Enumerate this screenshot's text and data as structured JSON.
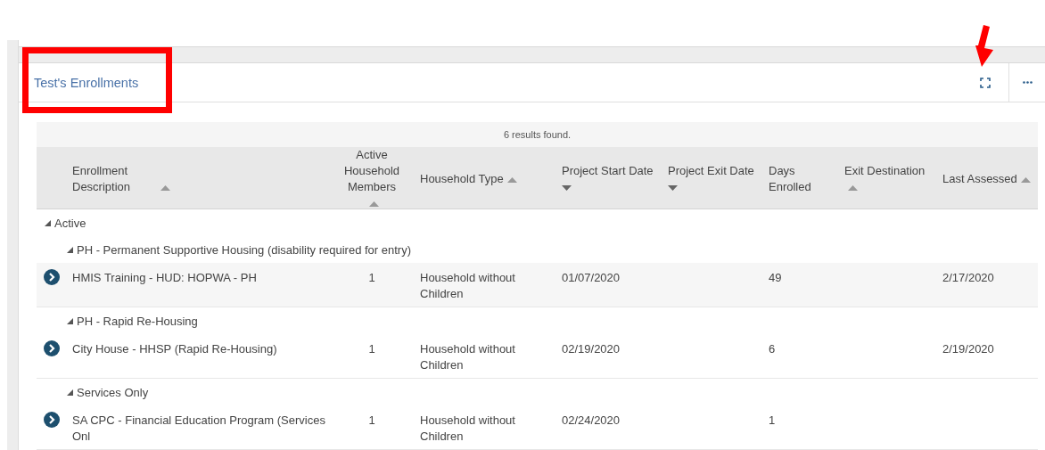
{
  "panel": {
    "title": "Test's Enrollments"
  },
  "toolbar": [
    {
      "kind": "expand"
    },
    {
      "kind": "more"
    }
  ],
  "results": "6 results found.",
  "columns": [
    {
      "label": "Enrollment Description",
      "kind": "text",
      "sorted_ascending": true
    },
    {
      "label": "Active Household Members",
      "kind": "count",
      "sorted_ascending": true
    },
    {
      "label": "Household Type",
      "kind": "text",
      "sorted_ascending": true
    },
    {
      "label": "Project Start Date",
      "kind": "text",
      "sorted_ascending": false
    },
    {
      "label": "Project Exit Date",
      "kind": "text",
      "sorted_ascending": false
    },
    {
      "label": "Days Enrolled",
      "kind": "text"
    },
    {
      "label": "Exit Destination",
      "kind": "text",
      "sorted_ascending": true
    },
    {
      "label": "Last Assessed",
      "kind": "text",
      "sorted_ascending": true
    }
  ],
  "groups": [
    {
      "label": "Active",
      "expanded": true,
      "children": [
        {
          "label": "PH - Permanent Supportive Housing (disability required for entry)",
          "expanded": true,
          "rows": [
            {
              "highlighted": true,
              "cells": [
                "HMIS Training - HUD: HOPWA - PH",
                "1",
                "Household without Children",
                "01/07/2020",
                null,
                "49",
                null,
                "2/17/2020"
              ]
            }
          ]
        },
        {
          "label": "PH - Rapid Re-Housing",
          "expanded": true,
          "rows": [
            {
              "highlighted": false,
              "cells": [
                "City House - HHSP (Rapid Re-Housing)",
                "1",
                "Household without Children",
                "02/19/2020",
                null,
                "6",
                null,
                "2/19/2020"
              ]
            }
          ]
        },
        {
          "label": "Services Only",
          "expanded": true,
          "rows": [
            {
              "highlighted": false,
              "cells": [
                "SA CPC - Financial Education Program (Services Onl",
                "1",
                "Household without Children",
                "02/24/2020",
                null,
                "1",
                null,
                null
              ]
            }
          ]
        }
      ]
    }
  ]
}
